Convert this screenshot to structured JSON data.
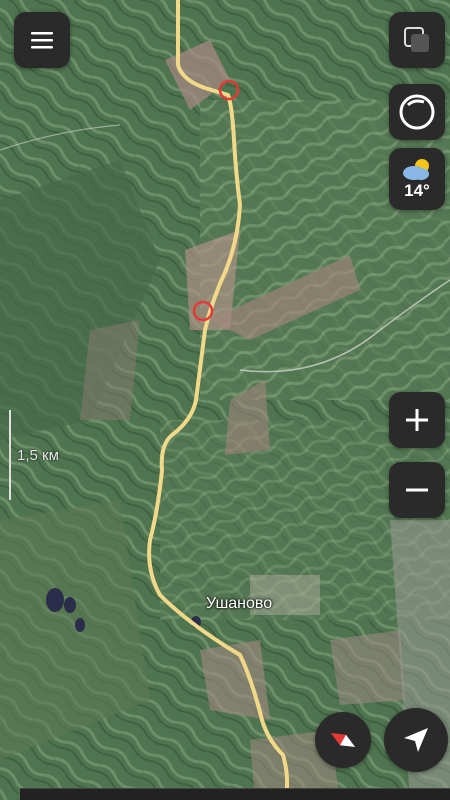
{
  "map": {
    "place_label": "Ушаново",
    "scale_label": "1,5 км"
  },
  "weather": {
    "temperature": "14°",
    "icon": "partly-cloudy-icon"
  },
  "controls": {
    "menu_icon": "hamburger-menu-icon",
    "layers_icon": "layers-icon",
    "night_mode_icon": "night-mode-icon",
    "zoom_in_icon": "plus-icon",
    "zoom_out_icon": "minus-icon",
    "compass_icon": "compass-icon",
    "locate_icon": "navigation-arrow-icon"
  },
  "colors": {
    "road": "#f2d98a",
    "marker": "#e53935",
    "button_bg": "#2a2a2a"
  }
}
